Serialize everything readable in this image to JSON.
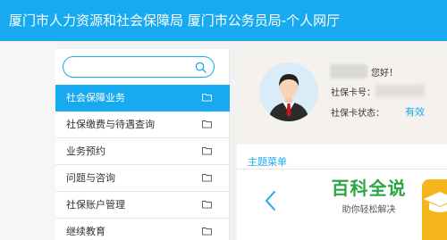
{
  "header": {
    "title": "厦门市人力资源和社会保障局 厦门市公务员局-个人网厅"
  },
  "search": {
    "placeholder": "",
    "value": ""
  },
  "menu": {
    "items": [
      {
        "label": "社会保障业务",
        "active": true
      },
      {
        "label": "社保缴费与待遇查询",
        "active": false
      },
      {
        "label": "业务预约",
        "active": false
      },
      {
        "label": "问题与咨询",
        "active": false
      },
      {
        "label": "社保账户管理",
        "active": false
      },
      {
        "label": "继续教育",
        "active": false
      }
    ]
  },
  "profile": {
    "greeting": "您好！",
    "card_number_label": "社保卡号：",
    "card_status_label": "社保卡状态：",
    "card_status_value": "有效"
  },
  "topics": {
    "title": "主题菜单"
  },
  "watermark": {
    "title": "百科全说",
    "subtitle": "助你轻松解决"
  },
  "icons": [
    "search-icon",
    "folder-icon",
    "chevron-left-icon",
    "graduation-cap-icon"
  ],
  "colors": {
    "accent": "#18aaf0",
    "watermark": "#2aa745",
    "tile": "#f4b61c"
  }
}
